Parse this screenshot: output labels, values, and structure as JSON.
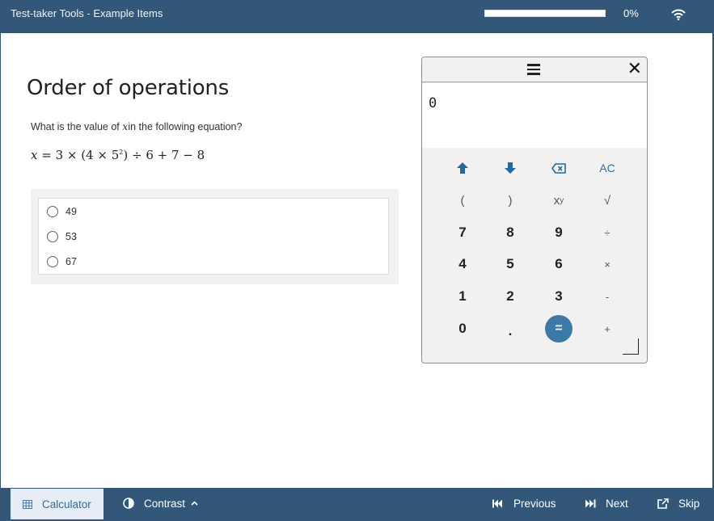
{
  "header": {
    "title": "Test-taker Tools - Example Items",
    "progress_percent": 0,
    "progress_label": "0%",
    "connection_icon": "wifi-icon"
  },
  "question": {
    "title": "Order of operations",
    "prompt_before": "What is the value of ",
    "prompt_var": "x",
    "prompt_after": "in the following equation?",
    "equation": {
      "lhs": "x",
      "part1": " = 3 × (4 × 5",
      "exponent": "2",
      "part2": ") ÷ 6 + 7 − 8"
    },
    "choices": [
      {
        "label": "49",
        "selected": false
      },
      {
        "label": "53",
        "selected": false
      },
      {
        "label": "67",
        "selected": false
      }
    ]
  },
  "calculator": {
    "menu_icon": "hamburger-menu-icon",
    "close_icon": "close-icon",
    "display_value": "0",
    "keys": {
      "up": "up-arrow-icon",
      "down": "down-arrow-icon",
      "backspace": "backspace-icon",
      "ac": "AC",
      "lparen": "(",
      "rparen": ")",
      "power_base": "x",
      "power_exp": "y",
      "sqrt": "√",
      "k7": "7",
      "k8": "8",
      "k9": "9",
      "div": "÷",
      "k4": "4",
      "k5": "5",
      "k6": "6",
      "mul": "×",
      "k1": "1",
      "k2": "2",
      "k3": "3",
      "sub": "-",
      "k0": "0",
      "dot": ".",
      "eq": "=",
      "add": "+"
    }
  },
  "footer": {
    "calculator_label": "Calculator",
    "calculator_active": true,
    "contrast_label": "Contrast",
    "previous_label": "Previous",
    "next_label": "Next",
    "skip_label": "Skip"
  },
  "colors": {
    "brand": "#325779",
    "accent": "#3a79a8",
    "active_tool_bg": "#e6edf4"
  }
}
